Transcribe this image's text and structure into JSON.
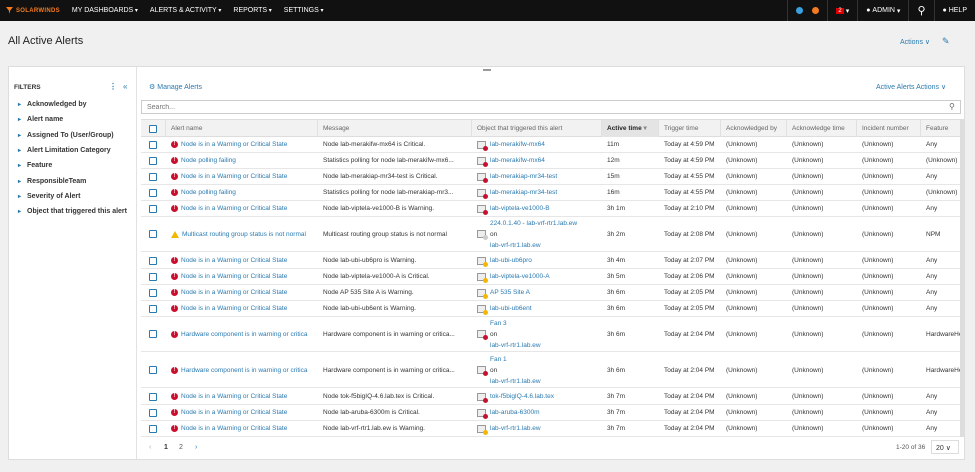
{
  "topbar": {
    "brand": "SOLARWINDS",
    "nav": [
      "MY DASHBOARDS",
      "ALERTS & ACTIVITY",
      "REPORTS",
      "SETTINGS"
    ],
    "notif_count": "2",
    "user": "ADMIN",
    "help": "HELP"
  },
  "page": {
    "title": "All Active Alerts",
    "actions": "Actions ∨"
  },
  "filters": {
    "title": "FILTERS",
    "items": [
      "Acknowledged by",
      "Alert name",
      "Assigned To (User/Group)",
      "Alert Limitation Category",
      "Feature",
      "ResponsibleTeam",
      "Severity of Alert",
      "Object that triggered this alert"
    ]
  },
  "toolbar": {
    "manage": "Manage Alerts",
    "active_actions": "Active Alerts Actions ∨",
    "search_placeholder": "Search..."
  },
  "columns": [
    "Alert name",
    "Message",
    "Object that triggered this alert",
    "Active time",
    "Trigger time",
    "Acknowledged by",
    "Acknowledge time",
    "Incident number",
    "Feature"
  ],
  "rows": [
    {
      "sev": "critical",
      "name": "Node is in a Warning or Critical State",
      "msg": "Node lab-merakifw-mx64 is Critical.",
      "obj": [
        "lab-merakifw-mx64"
      ],
      "ostat": "critical",
      "active": "11m",
      "trigger": "Today at 4:59 PM",
      "ackby": "(Unknown)",
      "acktime": "(Unknown)",
      "incident": "(Unknown)",
      "feature": "Any"
    },
    {
      "sev": "critical",
      "name": "Node polling failing",
      "msg": "Statistics polling for node lab-merakifw-mx6...",
      "obj": [
        "lab-merakifw-mx64"
      ],
      "ostat": "critical",
      "active": "12m",
      "trigger": "Today at 4:59 PM",
      "ackby": "(Unknown)",
      "acktime": "(Unknown)",
      "incident": "(Unknown)",
      "feature": "(Unknown)"
    },
    {
      "sev": "critical",
      "name": "Node is in a Warning or Critical State",
      "msg": "Node lab-merakiap-mr34-test is Critical.",
      "obj": [
        "lab-merakiap-mr34-test"
      ],
      "ostat": "critical",
      "active": "15m",
      "trigger": "Today at 4:55 PM",
      "ackby": "(Unknown)",
      "acktime": "(Unknown)",
      "incident": "(Unknown)",
      "feature": "Any"
    },
    {
      "sev": "critical",
      "name": "Node polling failing",
      "msg": "Statistics polling for node lab-merakiap-mr3...",
      "obj": [
        "lab-merakiap-mr34-test"
      ],
      "ostat": "critical",
      "active": "16m",
      "trigger": "Today at 4:55 PM",
      "ackby": "(Unknown)",
      "acktime": "(Unknown)",
      "incident": "(Unknown)",
      "feature": "(Unknown)"
    },
    {
      "sev": "critical",
      "name": "Node is in a Warning or Critical State",
      "msg": "Node lab-viptela-ve1000-B is Warning.",
      "obj": [
        "lab-viptela-ve1000-B"
      ],
      "ostat": "critical",
      "active": "3h 1m",
      "trigger": "Today at 2:10 PM",
      "ackby": "(Unknown)",
      "acktime": "(Unknown)",
      "incident": "(Unknown)",
      "feature": "Any"
    },
    {
      "sev": "warning",
      "name": "Multicast routing group status is not normal",
      "msg": "Multicast routing group status is not normal",
      "obj": [
        "224.0.1.40 - lab-vrf-rtr1.lab.ew",
        "on",
        "lab-vrf-rtr1.lab.ew"
      ],
      "ostat": "unknown",
      "active": "3h 2m",
      "trigger": "Today at 2:08 PM",
      "ackby": "(Unknown)",
      "acktime": "(Unknown)",
      "incident": "(Unknown)",
      "feature": "NPM"
    },
    {
      "sev": "critical",
      "name": "Node is in a Warning or Critical State",
      "msg": "Node lab-ubi-ub6pro is Warning.",
      "obj": [
        "lab-ubi-ub6pro"
      ],
      "ostat": "warning",
      "active": "3h 4m",
      "trigger": "Today at 2:07 PM",
      "ackby": "(Unknown)",
      "acktime": "(Unknown)",
      "incident": "(Unknown)",
      "feature": "Any"
    },
    {
      "sev": "critical",
      "name": "Node is in a Warning or Critical State",
      "msg": "Node lab-viptela-ve1000-A is Critical.",
      "obj": [
        "lab-viptela-ve1000-A"
      ],
      "ostat": "warning",
      "active": "3h 5m",
      "trigger": "Today at 2:06 PM",
      "ackby": "(Unknown)",
      "acktime": "(Unknown)",
      "incident": "(Unknown)",
      "feature": "Any"
    },
    {
      "sev": "critical",
      "name": "Node is in a Warning or Critical State",
      "msg": "Node AP 535 Site A is Warning.",
      "obj": [
        "AP 535 Site A"
      ],
      "ostat": "warning",
      "active": "3h 6m",
      "trigger": "Today at 2:05 PM",
      "ackby": "(Unknown)",
      "acktime": "(Unknown)",
      "incident": "(Unknown)",
      "feature": "Any"
    },
    {
      "sev": "critical",
      "name": "Node is in a Warning or Critical State",
      "msg": "Node lab-ubi-ub6ent is Warning.",
      "obj": [
        "lab-ubi-ub6ent"
      ],
      "ostat": "warning",
      "active": "3h 6m",
      "trigger": "Today at 2:05 PM",
      "ackby": "(Unknown)",
      "acktime": "(Unknown)",
      "incident": "(Unknown)",
      "feature": "Any"
    },
    {
      "sev": "critical",
      "name": "Hardware component is in warning or critica",
      "msg": "Hardware component is in warning or critica...",
      "obj": [
        "Fan 3",
        "on",
        "lab-vrf-rtr1.lab.ew"
      ],
      "ostat": "critical",
      "active": "3h 6m",
      "trigger": "Today at 2:04 PM",
      "ackby": "(Unknown)",
      "acktime": "(Unknown)",
      "incident": "(Unknown)",
      "feature": "HardwareHe"
    },
    {
      "sev": "critical",
      "name": "Hardware component is in warning or critica",
      "msg": "Hardware component is in warning or critica...",
      "obj": [
        "Fan 1",
        "on",
        "lab-vrf-rtr1.lab.ew"
      ],
      "ostat": "critical",
      "active": "3h 6m",
      "trigger": "Today at 2:04 PM",
      "ackby": "(Unknown)",
      "acktime": "(Unknown)",
      "incident": "(Unknown)",
      "feature": "HardwareHe"
    },
    {
      "sev": "critical",
      "name": "Node is in a Warning or Critical State",
      "msg": "Node tok-f5bigIQ-4.6.lab.tex is Critical.",
      "obj": [
        "tok-f5bigIQ-4.6.lab.tex"
      ],
      "ostat": "critical",
      "active": "3h 7m",
      "trigger": "Today at 2:04 PM",
      "ackby": "(Unknown)",
      "acktime": "(Unknown)",
      "incident": "(Unknown)",
      "feature": "Any"
    },
    {
      "sev": "critical",
      "name": "Node is in a Warning or Critical State",
      "msg": "Node lab-aruba-6300m is Critical.",
      "obj": [
        "lab-aruba-6300m"
      ],
      "ostat": "critical",
      "active": "3h 7m",
      "trigger": "Today at 2:04 PM",
      "ackby": "(Unknown)",
      "acktime": "(Unknown)",
      "incident": "(Unknown)",
      "feature": "Any"
    },
    {
      "sev": "critical",
      "name": "Node is in a Warning or Critical State",
      "msg": "Node lab-vrf-rtr1.lab.ew is Warning.",
      "obj": [
        "lab-vrf-rtr1.lab.ew"
      ],
      "ostat": "warning",
      "active": "3h 7m",
      "trigger": "Today at 2:04 PM",
      "ackby": "(Unknown)",
      "acktime": "(Unknown)",
      "incident": "(Unknown)",
      "feature": "Any"
    }
  ],
  "pagination": {
    "pages": [
      "1",
      "2"
    ],
    "count": "1-20 of 36",
    "page_size": "20 ∨"
  },
  "colors": {
    "link": "#2a7ab0",
    "critical": "#c8102e",
    "warning": "#f2b800",
    "brand": "#f47b20"
  }
}
